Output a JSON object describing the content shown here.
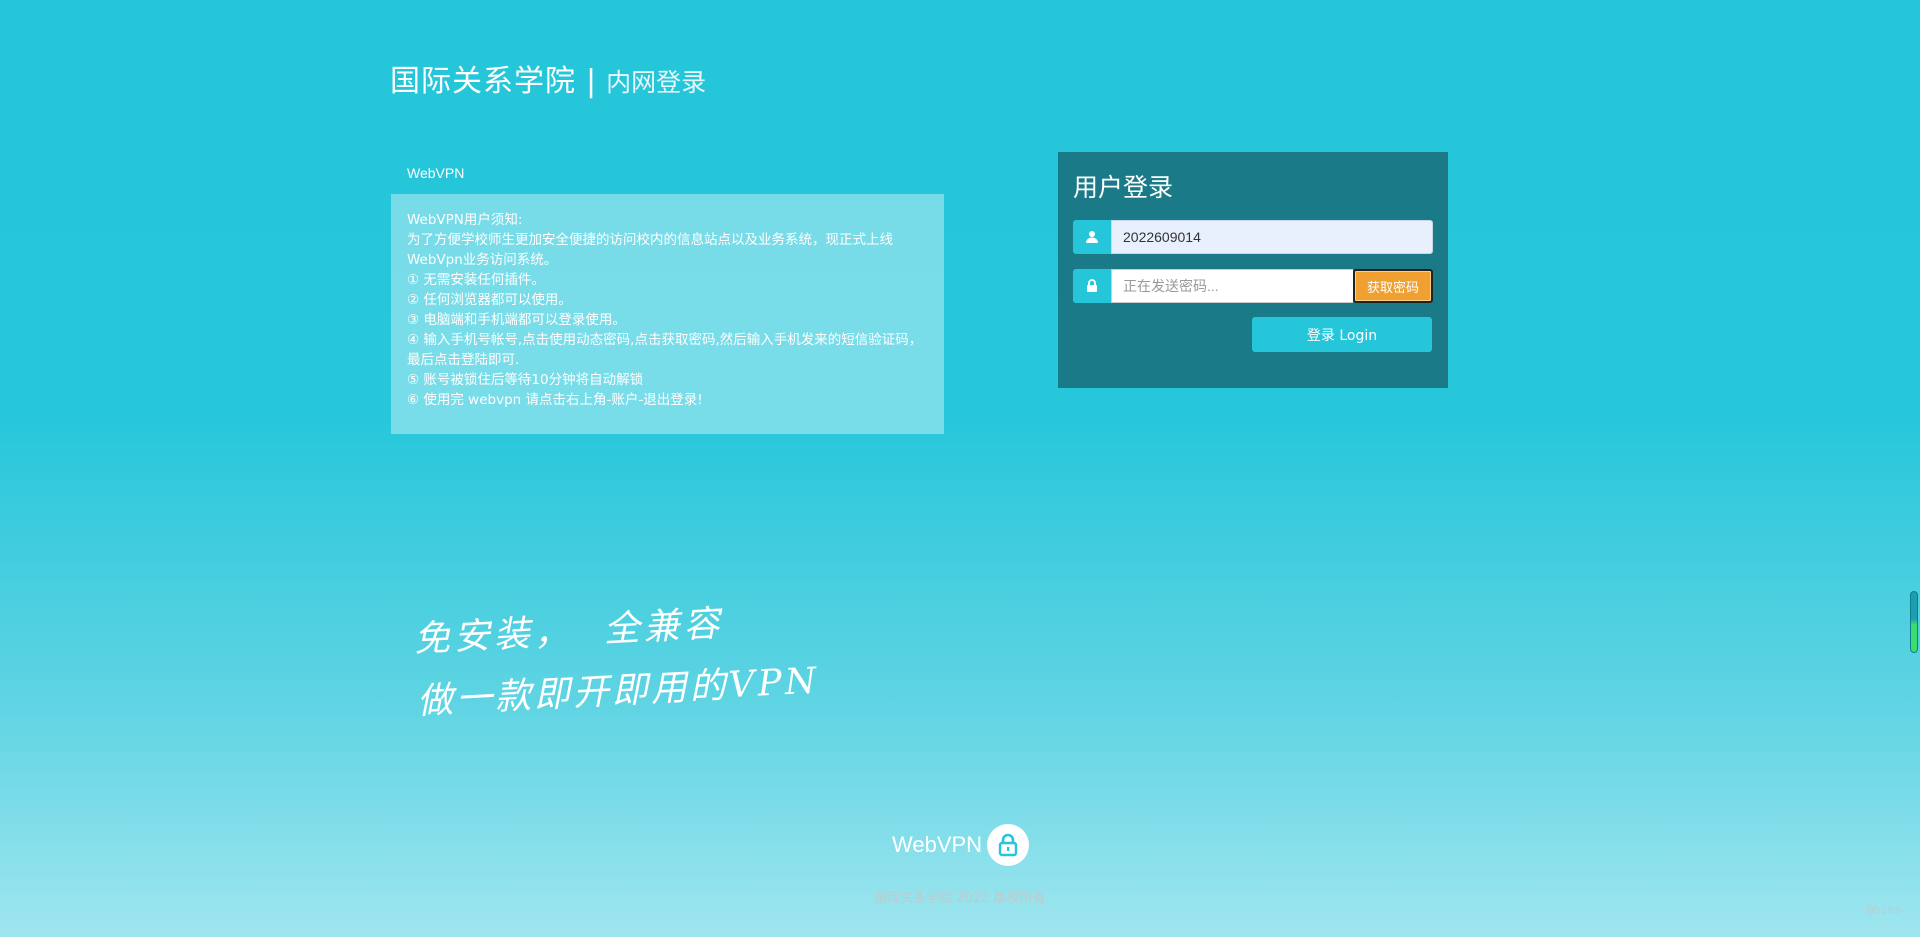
{
  "header": {
    "school": "国际关系学院",
    "separator": "|",
    "subtitle": "内网登录"
  },
  "notice": {
    "title": "WebVPN",
    "lines": [
      "WebVPN用户须知:",
      "为了方便学校师生更加安全便捷的访问校内的信息站点以及业务系统，现正式上线WebVpn业务访问系统。",
      "① 无需安装任何插件。",
      "② 任何浏览器都可以使用。",
      "③ 电脑端和手机端都可以登录使用。",
      "④ 输入手机号帐号,点击使用动态密码,点击获取密码,然后输入手机发来的短信验证码，最后点击登陆即可.",
      "⑤ 账号被锁住后等待10分钟将自动解锁",
      "⑥ 使用完 webvpn 请点击右上角-账户-退出登录!"
    ]
  },
  "login": {
    "title": "用户登录",
    "username_value": "2022609014",
    "password_placeholder": "正在发送密码...",
    "get_code_label": "获取密码",
    "login_label": "登录 Login",
    "user_icon": "user-icon",
    "lock_icon": "lock-icon"
  },
  "slogan": {
    "line1a": "免安装，",
    "line1b": "全兼容",
    "line2": "做一款即开即用的VPN"
  },
  "footer": {
    "logo_text": "WebVPN",
    "logo_icon": "lock-icon",
    "copyright": "国际关系学院 2022 版权所有",
    "credit": "@hins"
  },
  "colors": {
    "background": "#26c6da",
    "login_panel": "#1b7a87",
    "accent": "#26c6da",
    "get_code": "#f0a030"
  }
}
